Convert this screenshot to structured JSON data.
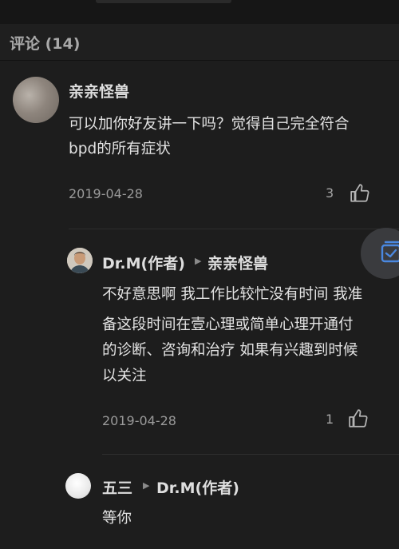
{
  "header": {
    "title": "评论 (14)"
  },
  "comments": [
    {
      "author": "亲亲怪兽",
      "text_lines": [
        "可以加你好友讲一下吗？觉得自己完全符合",
        "bpd的所有症状"
      ],
      "date": "2019-04-28",
      "likes": "3"
    },
    {
      "author": "Dr.M(作者)",
      "reply_to": "亲亲怪兽",
      "text_lines": [
        "不好意思啊 我工作比较忙没有时间 我准",
        "备这段时间在壹心理或简单心理开通付",
        "的诊断、咨询和治疗 如果有兴趣到时候",
        "以关注"
      ],
      "date": "2019-04-28",
      "likes": "1"
    },
    {
      "author": "五三",
      "reply_to": "Dr.M(作者)",
      "text_lines": [
        "等你"
      ]
    }
  ],
  "colors": {
    "background": "#1d1d1d",
    "accent": "#4a88e0"
  },
  "icons": {
    "like": "thumbs-up-icon",
    "float": "message-icon"
  }
}
